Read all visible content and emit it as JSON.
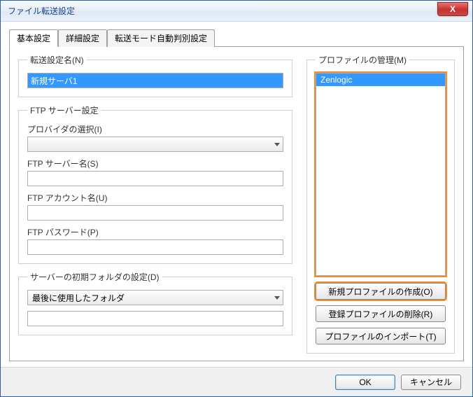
{
  "window": {
    "title": "ファイル転送設定"
  },
  "close_icon": "X",
  "tabs": {
    "basic": "基本設定",
    "detail": "詳細設定",
    "auto": "転送モード自動判別設定"
  },
  "group_name": {
    "legend": "転送設定名(N)",
    "value": "新規サーバ1"
  },
  "group_ftp": {
    "legend": "FTP サーバー設定",
    "provider_label": "プロバイダの選択(I)",
    "provider_value": "",
    "server_label": "FTP サーバー名(S)",
    "server_value": "",
    "account_label": "FTP アカウント名(U)",
    "account_value": "",
    "password_label": "FTP パスワード(P)",
    "password_value": ""
  },
  "group_initfolder": {
    "legend": "サーバーの初期フォルダの設定(D)",
    "combo_value": "最後に使用したフォルダ",
    "text_value": ""
  },
  "group_profile": {
    "legend": "プロファイルの管理(M)",
    "items": [
      "Zenlogic"
    ],
    "new_btn": "新規プロファイルの作成(O)",
    "delete_btn": "登録プロファイルの削除(R)",
    "import_btn": "プロファイルのインポート(T)"
  },
  "footer": {
    "ok": "OK",
    "cancel": "キャンセル"
  }
}
